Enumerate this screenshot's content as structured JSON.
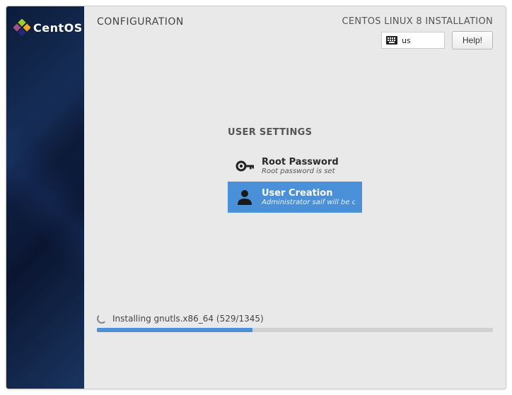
{
  "brand": "CentOS",
  "header": {
    "left_title": "CONFIGURATION",
    "right_title": "CENTOS LINUX 8 INSTALLATION",
    "keyboard_layout": "us",
    "help_label": "Help!"
  },
  "section": {
    "title": "USER SETTINGS"
  },
  "spokes": {
    "root": {
      "title": "Root Password",
      "subtitle": "Root password is set"
    },
    "user": {
      "title": "User Creation",
      "subtitle": "Administrator saif will be created"
    }
  },
  "progress": {
    "text": "Installing gnutls.x86_64 (529/1345)",
    "current": 529,
    "total": 1345,
    "percent": 39.3
  }
}
